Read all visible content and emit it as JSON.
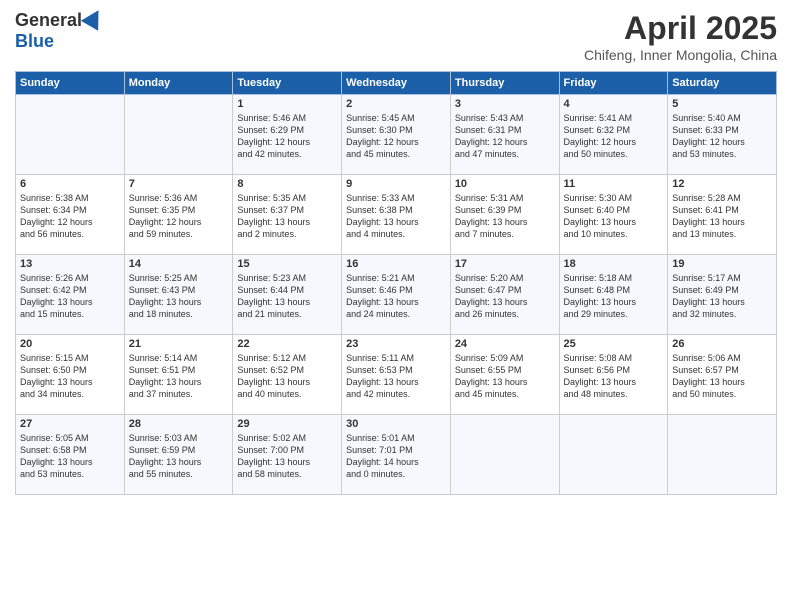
{
  "header": {
    "logo_general": "General",
    "logo_blue": "Blue",
    "month_title": "April 2025",
    "subtitle": "Chifeng, Inner Mongolia, China"
  },
  "days_of_week": [
    "Sunday",
    "Monday",
    "Tuesday",
    "Wednesday",
    "Thursday",
    "Friday",
    "Saturday"
  ],
  "weeks": [
    [
      {
        "day": "",
        "content": ""
      },
      {
        "day": "",
        "content": ""
      },
      {
        "day": "1",
        "content": "Sunrise: 5:46 AM\nSunset: 6:29 PM\nDaylight: 12 hours\nand 42 minutes."
      },
      {
        "day": "2",
        "content": "Sunrise: 5:45 AM\nSunset: 6:30 PM\nDaylight: 12 hours\nand 45 minutes."
      },
      {
        "day": "3",
        "content": "Sunrise: 5:43 AM\nSunset: 6:31 PM\nDaylight: 12 hours\nand 47 minutes."
      },
      {
        "day": "4",
        "content": "Sunrise: 5:41 AM\nSunset: 6:32 PM\nDaylight: 12 hours\nand 50 minutes."
      },
      {
        "day": "5",
        "content": "Sunrise: 5:40 AM\nSunset: 6:33 PM\nDaylight: 12 hours\nand 53 minutes."
      }
    ],
    [
      {
        "day": "6",
        "content": "Sunrise: 5:38 AM\nSunset: 6:34 PM\nDaylight: 12 hours\nand 56 minutes."
      },
      {
        "day": "7",
        "content": "Sunrise: 5:36 AM\nSunset: 6:35 PM\nDaylight: 12 hours\nand 59 minutes."
      },
      {
        "day": "8",
        "content": "Sunrise: 5:35 AM\nSunset: 6:37 PM\nDaylight: 13 hours\nand 2 minutes."
      },
      {
        "day": "9",
        "content": "Sunrise: 5:33 AM\nSunset: 6:38 PM\nDaylight: 13 hours\nand 4 minutes."
      },
      {
        "day": "10",
        "content": "Sunrise: 5:31 AM\nSunset: 6:39 PM\nDaylight: 13 hours\nand 7 minutes."
      },
      {
        "day": "11",
        "content": "Sunrise: 5:30 AM\nSunset: 6:40 PM\nDaylight: 13 hours\nand 10 minutes."
      },
      {
        "day": "12",
        "content": "Sunrise: 5:28 AM\nSunset: 6:41 PM\nDaylight: 13 hours\nand 13 minutes."
      }
    ],
    [
      {
        "day": "13",
        "content": "Sunrise: 5:26 AM\nSunset: 6:42 PM\nDaylight: 13 hours\nand 15 minutes."
      },
      {
        "day": "14",
        "content": "Sunrise: 5:25 AM\nSunset: 6:43 PM\nDaylight: 13 hours\nand 18 minutes."
      },
      {
        "day": "15",
        "content": "Sunrise: 5:23 AM\nSunset: 6:44 PM\nDaylight: 13 hours\nand 21 minutes."
      },
      {
        "day": "16",
        "content": "Sunrise: 5:21 AM\nSunset: 6:46 PM\nDaylight: 13 hours\nand 24 minutes."
      },
      {
        "day": "17",
        "content": "Sunrise: 5:20 AM\nSunset: 6:47 PM\nDaylight: 13 hours\nand 26 minutes."
      },
      {
        "day": "18",
        "content": "Sunrise: 5:18 AM\nSunset: 6:48 PM\nDaylight: 13 hours\nand 29 minutes."
      },
      {
        "day": "19",
        "content": "Sunrise: 5:17 AM\nSunset: 6:49 PM\nDaylight: 13 hours\nand 32 minutes."
      }
    ],
    [
      {
        "day": "20",
        "content": "Sunrise: 5:15 AM\nSunset: 6:50 PM\nDaylight: 13 hours\nand 34 minutes."
      },
      {
        "day": "21",
        "content": "Sunrise: 5:14 AM\nSunset: 6:51 PM\nDaylight: 13 hours\nand 37 minutes."
      },
      {
        "day": "22",
        "content": "Sunrise: 5:12 AM\nSunset: 6:52 PM\nDaylight: 13 hours\nand 40 minutes."
      },
      {
        "day": "23",
        "content": "Sunrise: 5:11 AM\nSunset: 6:53 PM\nDaylight: 13 hours\nand 42 minutes."
      },
      {
        "day": "24",
        "content": "Sunrise: 5:09 AM\nSunset: 6:55 PM\nDaylight: 13 hours\nand 45 minutes."
      },
      {
        "day": "25",
        "content": "Sunrise: 5:08 AM\nSunset: 6:56 PM\nDaylight: 13 hours\nand 48 minutes."
      },
      {
        "day": "26",
        "content": "Sunrise: 5:06 AM\nSunset: 6:57 PM\nDaylight: 13 hours\nand 50 minutes."
      }
    ],
    [
      {
        "day": "27",
        "content": "Sunrise: 5:05 AM\nSunset: 6:58 PM\nDaylight: 13 hours\nand 53 minutes."
      },
      {
        "day": "28",
        "content": "Sunrise: 5:03 AM\nSunset: 6:59 PM\nDaylight: 13 hours\nand 55 minutes."
      },
      {
        "day": "29",
        "content": "Sunrise: 5:02 AM\nSunset: 7:00 PM\nDaylight: 13 hours\nand 58 minutes."
      },
      {
        "day": "30",
        "content": "Sunrise: 5:01 AM\nSunset: 7:01 PM\nDaylight: 14 hours\nand 0 minutes."
      },
      {
        "day": "",
        "content": ""
      },
      {
        "day": "",
        "content": ""
      },
      {
        "day": "",
        "content": ""
      }
    ]
  ]
}
